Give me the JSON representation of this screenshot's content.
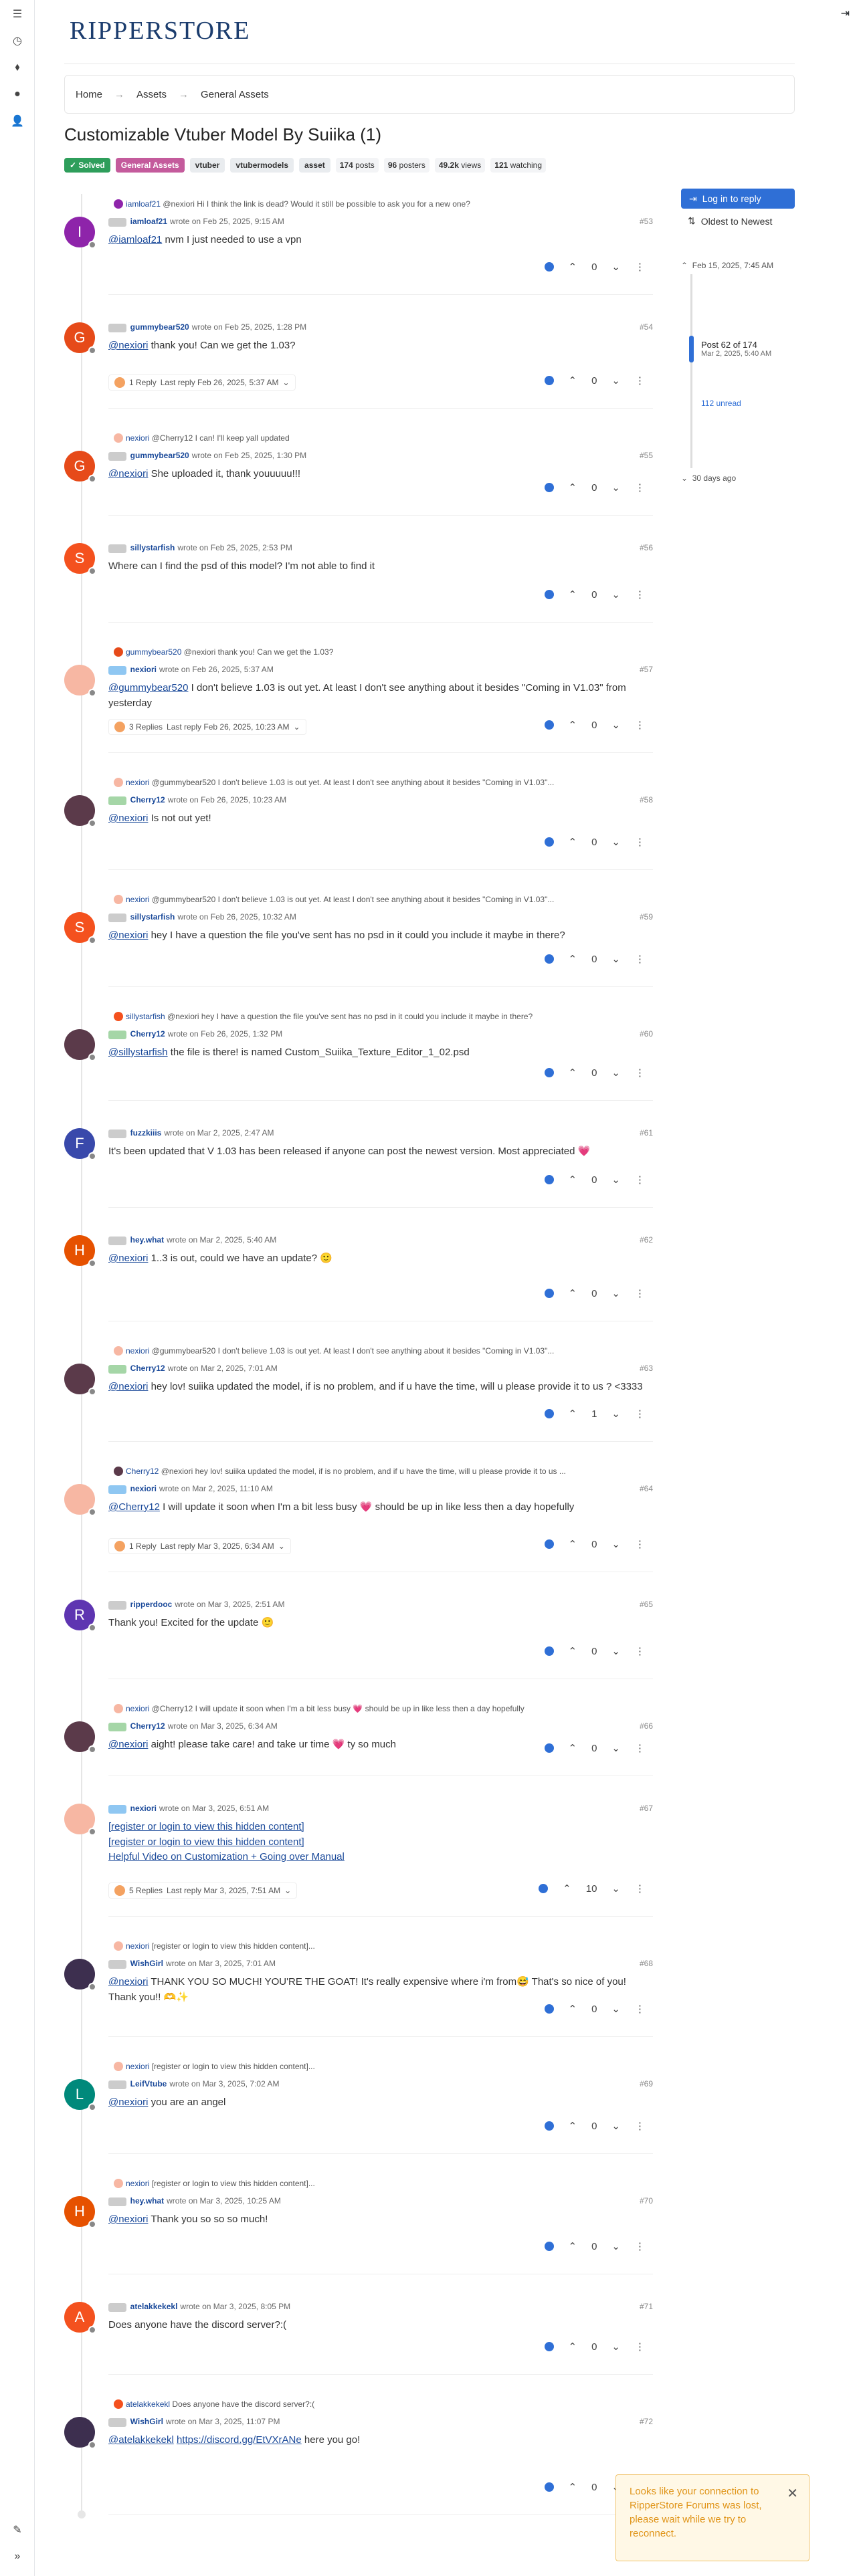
{
  "brand": "RIPPERSTORE",
  "breadcrumbs": [
    "Home",
    "Assets",
    "General Assets"
  ],
  "topic_title": "Customizable Vtuber Model By Suiika (1)",
  "tags": {
    "solved": "✓ Solved",
    "category": "General Assets",
    "t1": "vtuber",
    "t2": "vtubermodels",
    "t3": "asset"
  },
  "stats": {
    "posts_n": "174",
    "posts_l": "posts",
    "posters_n": "96",
    "posters_l": "posters",
    "views_n": "49.2k",
    "views_l": "views",
    "watching_n": "121",
    "watching_l": "watching"
  },
  "sidebar": {
    "login": "Log in to reply",
    "sort": "Oldest to Newest",
    "start": "Feb 15, 2025, 7:45 AM",
    "pos": "Post 62 of 174",
    "pos_date": "Mar 2, 2025, 5:40 AM",
    "unread": "112 unread",
    "ago": "30 days ago"
  },
  "toast": "Looks like your connection to RipperStore Forums was lost, please wait while we try to reconnect.",
  "posts": [
    {
      "ref_user": "iamloaf21",
      "ref_text": "@nexiori Hi I think the link is dead? Would it still be possible to ask you for a new one?",
      "user": "iamloaf21",
      "wrote": "wrote on Feb 25, 2025, 9:15 AM",
      "idx": "#53",
      "mention": "@iamloaf21",
      "text": " nvm I just needed to use a vpn",
      "votes": "0"
    },
    {
      "user": "gummybear520",
      "wrote": "wrote on Feb 25, 2025, 1:28 PM",
      "idx": "#54",
      "mention": "@nexiori",
      "text": " thank you! Can we get the 1.03?",
      "votes": "0",
      "replies": "1 Reply",
      "last": "Last reply Feb 26, 2025, 5:37 AM"
    },
    {
      "ref_user": "nexiori",
      "ref_text": "@Cherry12 I can! I'll keep yall updated",
      "user": "gummybear520",
      "wrote": "wrote on Feb 25, 2025, 1:30 PM",
      "idx": "#55",
      "mention": "@nexiori",
      "text": " She uploaded it, thank youuuuu!!!",
      "votes": "0"
    },
    {
      "user": "sillystarfish",
      "wrote": "wrote on Feb 25, 2025, 2:53 PM",
      "idx": "#56",
      "mention": "",
      "text": "Where can I find the psd of this model? I'm not able to find it",
      "votes": "0"
    },
    {
      "ref_user": "gummybear520",
      "ref_text": "@nexiori thank you! Can we get the 1.03?",
      "user": "nexiori",
      "wrote": "wrote on Feb 26, 2025, 5:37 AM",
      "idx": "#57",
      "mention": "@gummybear520",
      "text": " I don't believe 1.03 is out yet. At least I don't see anything about it besides \"Coming in V1.03\" from yesterday",
      "votes": "0",
      "replies": "3 Replies",
      "last": "Last reply Feb 26, 2025, 10:23 AM"
    },
    {
      "ref_user": "nexiori",
      "ref_text": "@gummybear520 I don't believe 1.03 is out yet. At least I don't see anything about it besides \"Coming in V1.03\"...",
      "user": "Cherry12",
      "wrote": "wrote on Feb 26, 2025, 10:23 AM",
      "idx": "#58",
      "mention": "@nexiori",
      "text": " Is not out yet!",
      "votes": "0"
    },
    {
      "ref_user": "nexiori",
      "ref_text": "@gummybear520 I don't believe 1.03 is out yet. At least I don't see anything about it besides \"Coming in V1.03\"...",
      "user": "sillystarfish",
      "wrote": "wrote on Feb 26, 2025, 10:32 AM",
      "idx": "#59",
      "mention": "@nexiori",
      "text": " hey I have a question the file you've sent has no psd in it could you include it maybe in there?",
      "votes": "0"
    },
    {
      "ref_user": "sillystarfish",
      "ref_text": "@nexiori hey I have a question the file you've sent has no psd in it could you include it maybe in there?",
      "user": "Cherry12",
      "wrote": "wrote on Feb 26, 2025, 1:32 PM",
      "idx": "#60",
      "mention": "@sillystarfish",
      "text": " the file is there! is named Custom_Suiika_Texture_Editor_1_02.psd",
      "votes": "0"
    },
    {
      "user": "fuzzkiiis",
      "wrote": "wrote on Mar 2, 2025, 2:47 AM",
      "idx": "#61",
      "mention": "",
      "text": "It's been updated that V 1.03 has been released if anyone can post the newest version. Most appreciated 💗",
      "votes": "0"
    },
    {
      "user": "hey.what",
      "wrote": "wrote on Mar 2, 2025, 5:40 AM",
      "idx": "#62",
      "mention": "@nexiori",
      "text": " 1..3 is out, could we have an update? 🙂",
      "votes": "0"
    },
    {
      "ref_user": "nexiori",
      "ref_text": "@gummybear520 I don't believe 1.03 is out yet. At least I don't see anything about it besides \"Coming in V1.03\"...",
      "user": "Cherry12",
      "wrote": "wrote on Mar 2, 2025, 7:01 AM",
      "idx": "#63",
      "mention": "@nexiori",
      "text": " hey lov! suiika updated the model, if is no problem, and if u have the time, will u please provide it to us ? <3333",
      "votes": "1"
    },
    {
      "ref_user": "Cherry12",
      "ref_text": "@nexiori hey lov! suiika updated the model, if is no problem, and if u have the time, will u please provide it to us ...",
      "user": "nexiori",
      "wrote": "wrote on Mar 2, 2025, 11:10 AM",
      "idx": "#64",
      "mention": "@Cherry12",
      "text": " I will update it soon when I'm a bit less busy 💗 should be up in like less then a day hopefully",
      "votes": "0",
      "replies": "1 Reply",
      "last": "Last reply Mar 3, 2025, 6:34 AM"
    },
    {
      "user": "ripperdooc",
      "wrote": "wrote on Mar 3, 2025, 2:51 AM",
      "idx": "#65",
      "mention": "",
      "text": "Thank you! Excited for the update 🙂",
      "votes": "0"
    },
    {
      "ref_user": "nexiori",
      "ref_text": "@Cherry12 I will update it soon when I'm a bit less busy 💗 should be up in like less then a day hopefully",
      "user": "Cherry12",
      "wrote": "wrote on Mar 3, 2025, 6:34 AM",
      "idx": "#66",
      "mention": "@nexiori",
      "text": " aight! please take care! and take ur time 💗 ty so much",
      "votes": "0"
    },
    {
      "user": "nexiori",
      "wrote": "wrote on Mar 3, 2025, 6:51 AM",
      "idx": "#67",
      "mention": "",
      "text": "",
      "links": [
        "[register or login to view this hidden content]",
        "[register or login to view this hidden content]",
        "Helpful Video on Customization + Going over Manual"
      ],
      "votes": "10",
      "replies": "5 Replies",
      "last": "Last reply Mar 3, 2025, 7:51 AM"
    },
    {
      "ref_user": "nexiori",
      "ref_text": "[register or login to view this hidden content]...",
      "user": "WishGirl",
      "wrote": "wrote on Mar 3, 2025, 7:01 AM",
      "idx": "#68",
      "mention": "@nexiori",
      "text": " THANK YOU SO MUCH! YOU'RE THE GOAT! It's really expensive where i'm from😅 That's so nice of you! Thank you!! 🫶✨",
      "votes": "0"
    },
    {
      "ref_user": "nexiori",
      "ref_text": "[register or login to view this hidden content]...",
      "user": "LeifVtube",
      "wrote": "wrote on Mar 3, 2025, 7:02 AM",
      "idx": "#69",
      "mention": "@nexiori",
      "text": " you are an angel",
      "votes": "0"
    },
    {
      "ref_user": "nexiori",
      "ref_text": "[register or login to view this hidden content]...",
      "user": "hey.what",
      "wrote": "wrote on Mar 3, 2025, 10:25 AM",
      "idx": "#70",
      "mention": "@nexiori",
      "text": " Thank you so so so much!",
      "votes": "0"
    },
    {
      "user": "atelakkekekl",
      "wrote": "wrote on Mar 3, 2025, 8:05 PM",
      "idx": "#71",
      "mention": "",
      "text": "Does anyone have the discord server?:(",
      "votes": "0"
    },
    {
      "ref_user": "atelakkekekl",
      "ref_text": "Does anyone have the discord server?:(",
      "user": "WishGirl",
      "wrote": "wrote on Mar 3, 2025, 11:07 PM",
      "idx": "#72",
      "mention": "@atelakkekekl",
      "text": " here you go!",
      "link2": "https://discord.gg/EtVXrANe",
      "votes": "0"
    }
  ]
}
